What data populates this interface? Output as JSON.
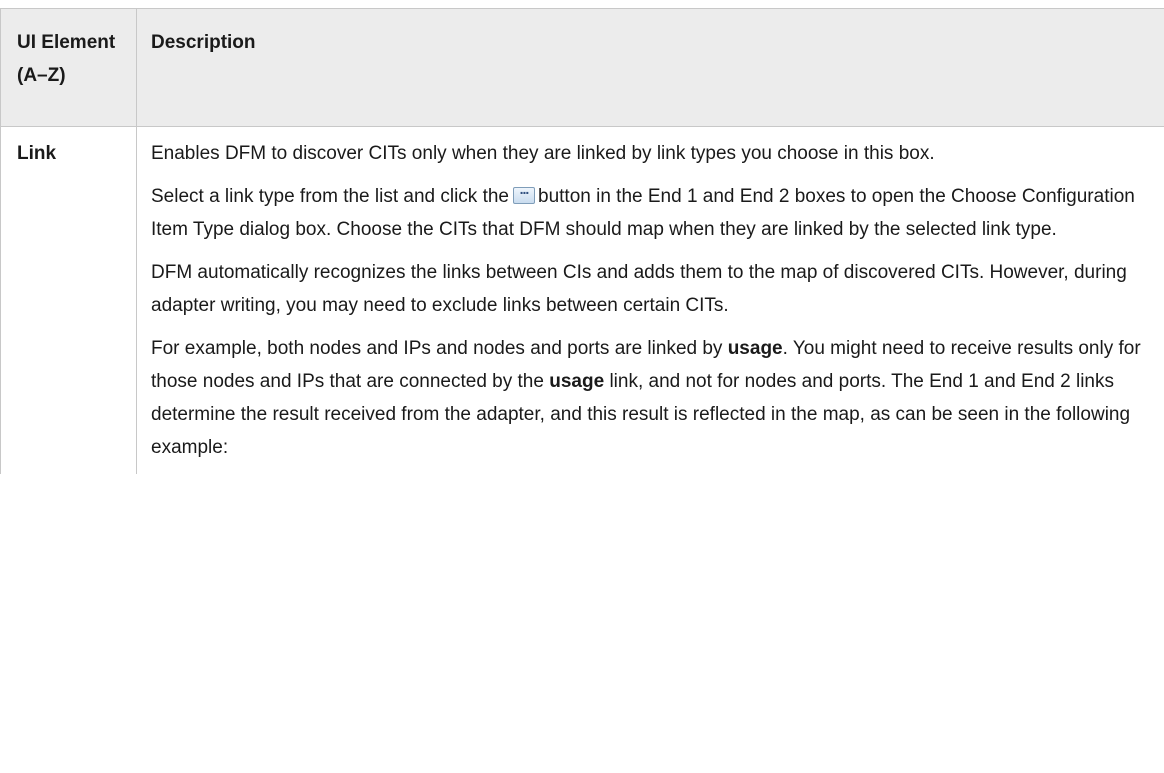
{
  "table": {
    "headers": {
      "element": "UI Element (A–Z)",
      "description": "Description"
    },
    "row": {
      "element": "Link",
      "p1": "Enables DFM to discover CITs only when they are linked by link types you choose in this box.",
      "p2_before": "Select a link type from the list and click the",
      "p2_after": "button in the End 1 and End 2 boxes to open the Choose Configuration Item Type dialog box. Choose the CITs that DFM should map when they are linked by the selected link type.",
      "p3": "DFM automatically recognizes the links between CIs and adds them to the map of discovered CITs. However, during adapter writing, you may need to exclude links between certain CITs.",
      "p4_part1": "For example, both nodes and IPs and nodes and ports are linked by",
      "p4_bold1": "usage",
      "p4_part2": ". You might need to receive results only for those nodes and IPs that are connected by the",
      "p4_bold2": "usage",
      "p4_part3": "link, and not for nodes and ports. The End 1 and End 2 links determine the result received from the adapter, and this result is reflected in the map, as can be seen in the following example:"
    }
  },
  "icons": {
    "browse_button": "ellipsis-button-icon"
  }
}
